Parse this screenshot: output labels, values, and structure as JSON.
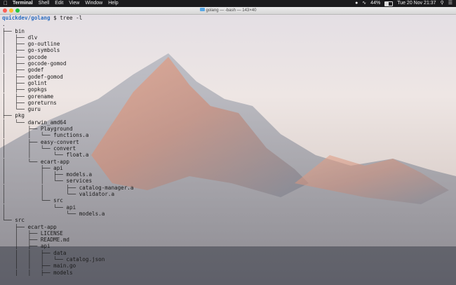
{
  "menubar": {
    "app_name": "Terminal",
    "menus": [
      "Shell",
      "Edit",
      "View",
      "Window",
      "Help"
    ],
    "battery_percent": "44%",
    "battery_level": 0.44,
    "datetime": "Tue 20 Nov  21:37"
  },
  "window": {
    "title": "golang — -bash — 143×40"
  },
  "terminal": {
    "prompt_user": "quickdev/golang",
    "prompt_symbol": " $ ",
    "command": "tree -l",
    "lines": [
      ".",
      "├── bin",
      "│   ├── dlv",
      "│   ├── go-outline",
      "│   ├── go-symbols",
      "│   ├── gocode",
      "│   ├── gocode-gomod",
      "│   ├── godef",
      "│   ├── godef-gomod",
      "│   ├── golint",
      "│   ├── gopkgs",
      "│   ├── gorename",
      "│   ├── goreturns",
      "│   └── guru",
      "├── pkg",
      "│   └── darwin_amd64",
      "│       ├── Playground",
      "│       │   └── functions.a",
      "│       ├── easy-convert",
      "│       │   └── convert",
      "│       │       └── float.a",
      "│       └── ecart-app",
      "│           ├── api",
      "│           │   ├── models.a",
      "│           │   └── services",
      "│           │       ├── catalog-manager.a",
      "│           │       └── validator.a",
      "│           └── src",
      "│               └── api",
      "│                   └── models.a",
      "└── src",
      "    ├── ecart-app",
      "    │   ├── LICENSE",
      "    │   ├── README.md",
      "    │   ├── api",
      "    │   │   ├── data",
      "    │   │   │   └── catalog.json",
      "    │   │   ├── main.go",
      "    │   │   ├── models"
    ]
  }
}
